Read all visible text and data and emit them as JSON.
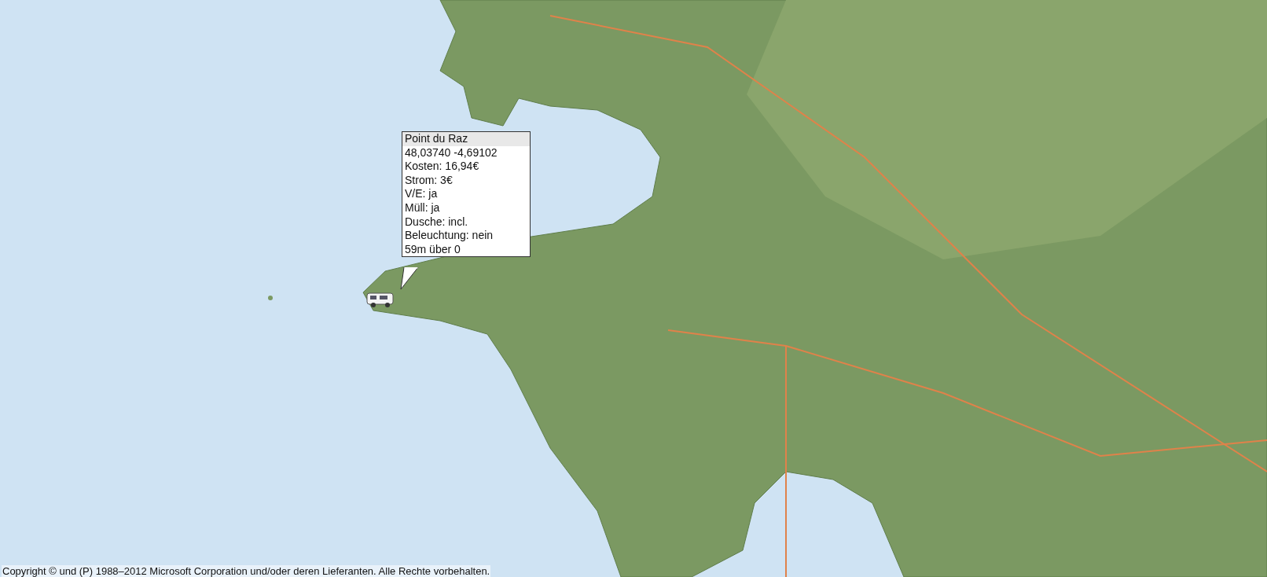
{
  "popup": {
    "title": "Point du Raz",
    "lines": [
      "48,03740 -4,69102",
      "Kosten: 16,94€",
      "Strom: 3€",
      "V/E: ja",
      "Müll: ja",
      "Dusche: incl.",
      "Beleuchtung: nein",
      "59m über 0"
    ]
  },
  "copyright": "Copyright © und (P) 1988–2012 Microsoft Corporation und/oder deren Lieferanten. Alle Rechte vorbehalten."
}
